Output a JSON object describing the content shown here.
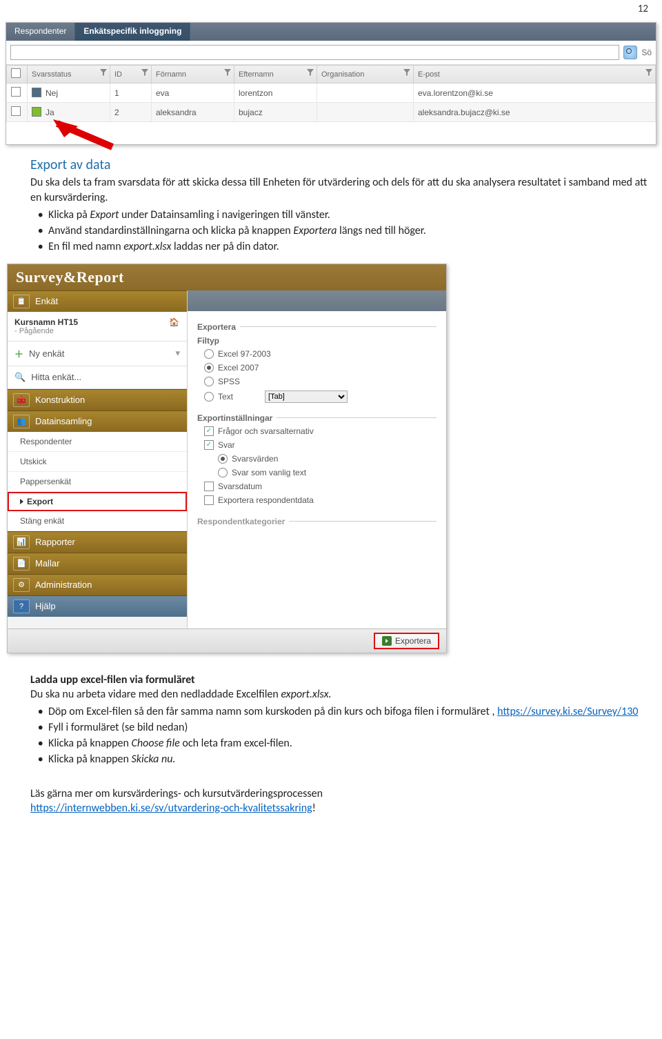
{
  "page_number": "12",
  "shot1": {
    "tabs": {
      "respondenter": "Respondenter",
      "enkat": "Enkätspecifik inloggning"
    },
    "search": {
      "placeholder": "",
      "button_label": "Sö"
    },
    "columns": {
      "chk": "",
      "svarsstatus": "Svarsstatus",
      "id": "ID",
      "fornamn": "Förnamn",
      "efternamn": "Efternamn",
      "organisation": "Organisation",
      "epost": "E-post"
    },
    "rows": [
      {
        "status_label": "Nej",
        "status_class": "status-n",
        "id": "1",
        "fornamn": "eva",
        "efternamn": "lorentzon",
        "organisation": "",
        "epost": "eva.lorentzon@ki.se"
      },
      {
        "status_label": "Ja",
        "status_class": "status-j",
        "id": "2",
        "fornamn": "aleksandra",
        "efternamn": "bujacz",
        "organisation": "",
        "epost": "aleksandra.bujacz@ki.se"
      }
    ]
  },
  "text": {
    "heading1": "Export av data",
    "p1": "Du ska dels ta fram svarsdata för att skicka dessa till Enheten för utvärdering och dels för att du ska analysera resultatet i samband med att en kursvärdering.",
    "b1_pre": "Klicka på ",
    "b1_i": "Export",
    "b1_post": " under Datainsamling i navigeringen till vänster.",
    "b2_pre": "Använd standardinställningarna och klicka på knappen ",
    "b2_i": "Exportera",
    "b2_post": " längs ned till höger.",
    "b3_pre": "En fil med namn ",
    "b3_i": "export.xlsx",
    "b3_post": " laddas ner på din dator.",
    "heading2": "Ladda upp excel-filen via formuläret",
    "p2_pre": "Du ska nu arbeta vidare med den nedladdade Excelfilen ",
    "p2_i": "export.xlsx.",
    "c1": "Döp om Excel-filen så den får samma namn som kurskoden på din kurs och bifoga filen i formuläret , ",
    "c1_link": "https://survey.ki.se/Survey/130",
    "c2": "Fyll i formuläret (se bild nedan)",
    "c3_pre": "Klicka på knappen ",
    "c3_i": "Choose file",
    "c3_post": " och leta fram excel-filen.",
    "c4_pre": "Klicka på knappen ",
    "c4_i": "Skicka nu.",
    "foot1": "Läs gärna mer om kursvärderings- och kursutvärderingsprocessen",
    "foot_link": "https://internwebben.ki.se/sv/utvardering-och-kvalitetssakring",
    "foot_excl": "!"
  },
  "shot2": {
    "logo": "Survey&Report",
    "sections": {
      "enkat": "Enkät",
      "konstruktion": "Konstruktion",
      "datainsamling": "Datainsamling",
      "rapporter": "Rapporter",
      "mallar": "Mallar",
      "administration": "Administration",
      "hjalp": "Hjälp"
    },
    "kurs": {
      "name": "Kursnamn HT15",
      "sub": "- Pågående"
    },
    "links": {
      "ny": "Ny enkät",
      "hitta": "Hitta enkät..."
    },
    "subitems": {
      "respondenter": "Respondenter",
      "utskick": "Utskick",
      "pappersenkat": "Pappersenkät",
      "export": "Export",
      "stang": "Stäng enkät"
    },
    "panel": {
      "exportera": "Exportera",
      "filtyp": "Filtyp",
      "excel97": "Excel 97-2003",
      "excel2007": "Excel 2007",
      "spss": "SPSS",
      "text": "Text",
      "tab": "[Tab]",
      "expinst": "Exportinställningar",
      "fragor": "Frågor och svarsalternativ",
      "svar": "Svar",
      "svarsvarden": "Svarsvärden",
      "svarvanlig": "Svar som vanlig text",
      "svarsdatum": "Svarsdatum",
      "exprespdata": "Exportera respondentdata",
      "respkat": "Respondentkategorier",
      "export_btn": "Exportera"
    }
  }
}
